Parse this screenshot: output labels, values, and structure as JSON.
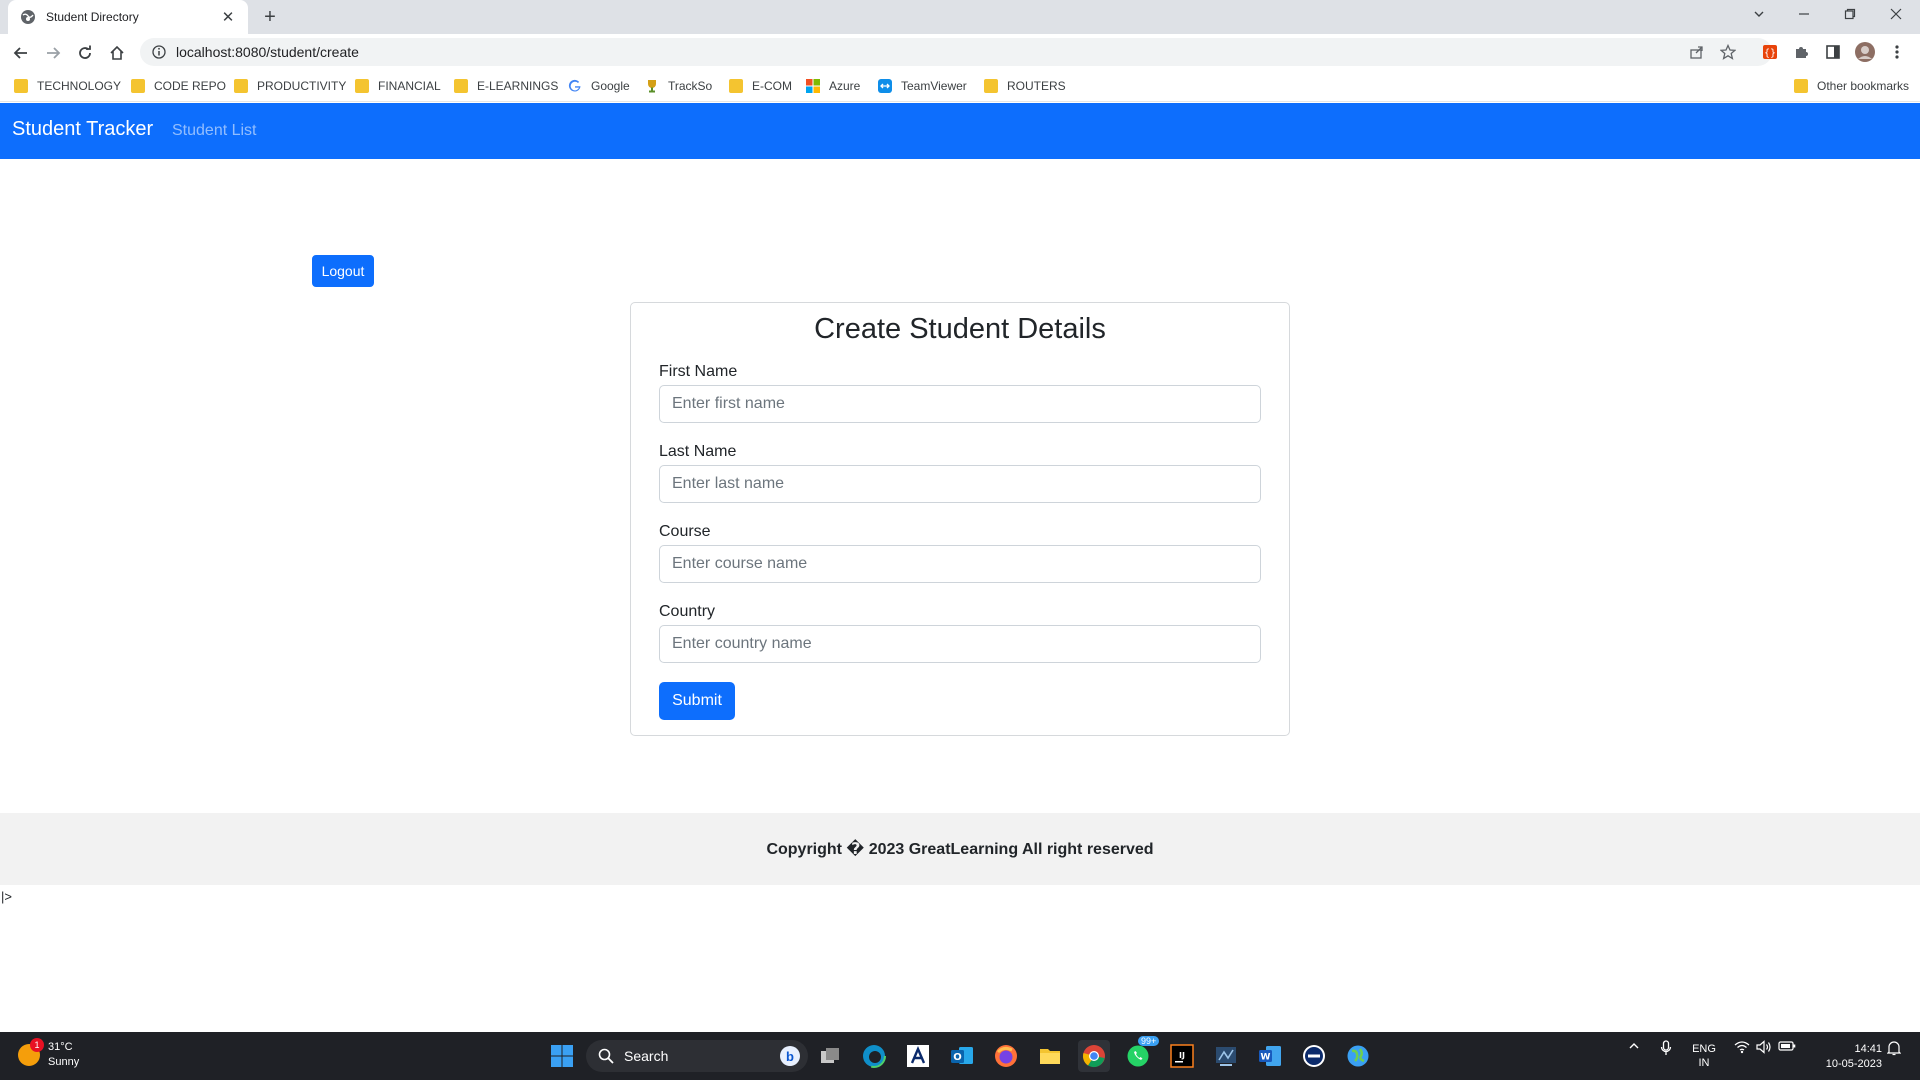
{
  "browser": {
    "tab_title": "Student Directory",
    "tab_close": "✕",
    "new_tab": "+",
    "url": "localhost:8080/student/create",
    "bookmarks": [
      {
        "label": "TECHNOLOGY",
        "icon": "folder-icon"
      },
      {
        "label": "CODE REPO",
        "icon": "folder-icon"
      },
      {
        "label": "PRODUCTIVITY",
        "icon": "folder-icon"
      },
      {
        "label": "FINANCIAL",
        "icon": "folder-icon"
      },
      {
        "label": "E-LEARNINGS",
        "icon": "folder-icon"
      },
      {
        "label": "Google",
        "icon": "google-icon"
      },
      {
        "label": "TrackSo",
        "icon": "trophy-icon"
      },
      {
        "label": "E-COM",
        "icon": "folder-icon"
      },
      {
        "label": "Azure",
        "icon": "microsoft-icon"
      },
      {
        "label": "TeamViewer",
        "icon": "teamviewer-icon"
      },
      {
        "label": "ROUTERS",
        "icon": "folder-icon"
      }
    ],
    "other_bookmarks": "Other bookmarks"
  },
  "app": {
    "brand": "Student Tracker",
    "nav_link": "Student List",
    "logout": "Logout",
    "form": {
      "title": "Create Student Details",
      "fields": [
        {
          "label": "First Name",
          "placeholder": "Enter first name"
        },
        {
          "label": "Last Name",
          "placeholder": "Enter last name"
        },
        {
          "label": "Course",
          "placeholder": "Enter course name"
        },
        {
          "label": "Country",
          "placeholder": "Enter country name"
        }
      ],
      "submit": "Submit"
    },
    "footer": "Copyright � 2023 GreatLearning All right reserved",
    "stray_text": "|>"
  },
  "taskbar": {
    "weather_temp": "31°C",
    "weather_desc": "Sunny",
    "weather_badge": "1",
    "search": "Search",
    "whatsapp_badge": "99+",
    "lang_line1": "ENG",
    "lang_line2": "IN",
    "time": "14:41",
    "date": "10-05-2023"
  },
  "colors": {
    "primary": "#0d6efd",
    "tabstrip": "#dee1e6",
    "taskbar": "#1f2126",
    "footer_bg": "#f2f2f2"
  }
}
